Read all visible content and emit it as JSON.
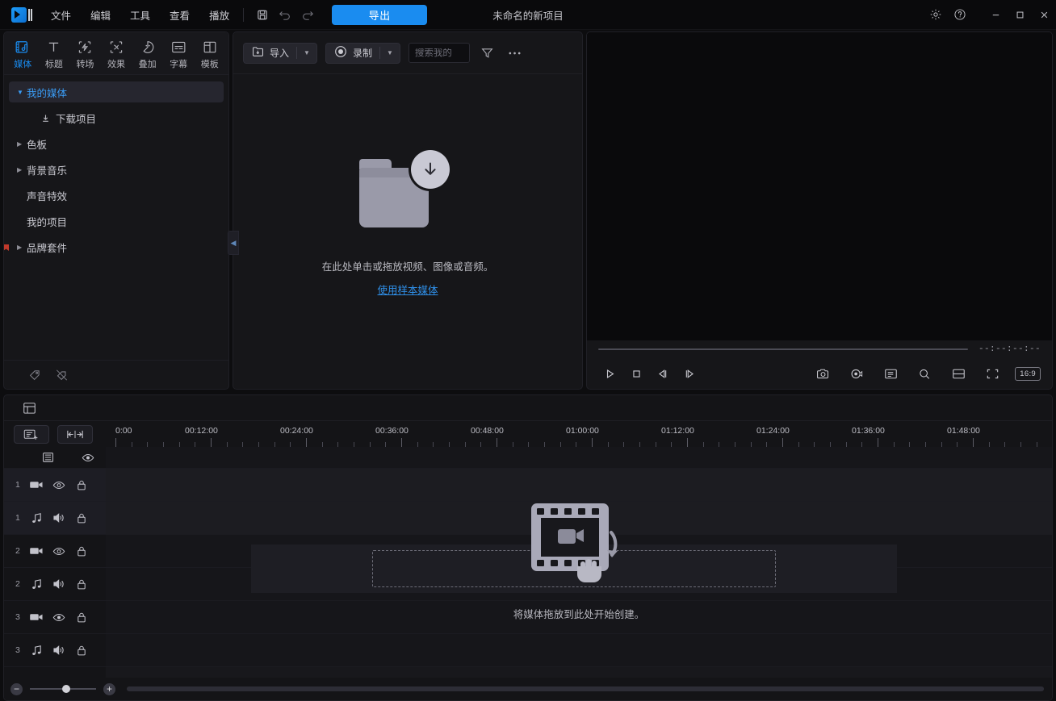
{
  "titlebar": {
    "menus": [
      "文件",
      "编辑",
      "工具",
      "查看",
      "播放"
    ],
    "save_icon": "save-icon",
    "undo_icon": "undo-icon",
    "redo_icon": "redo-icon",
    "export_label": "导出",
    "project_title": "未命名的新项目",
    "settings_icon": "gear-icon",
    "help_icon": "help-icon",
    "minimize_icon": "minimize-icon",
    "maximize_icon": "maximize-icon",
    "close_icon": "close-icon"
  },
  "category_tabs": [
    {
      "label": "媒体",
      "icon": "media-icon",
      "active": true
    },
    {
      "label": "标题",
      "icon": "text-title-icon",
      "active": false
    },
    {
      "label": "转场",
      "icon": "transition-icon",
      "active": false
    },
    {
      "label": "效果",
      "icon": "effects-icon",
      "active": false
    },
    {
      "label": "叠加",
      "icon": "overlay-icon",
      "active": false
    },
    {
      "label": "字幕",
      "icon": "subtitle-icon",
      "active": false
    },
    {
      "label": "模板",
      "icon": "template-icon",
      "active": false
    }
  ],
  "sidebar": {
    "items": [
      {
        "label": "我的媒体",
        "type": "expanded-parent",
        "selected": true
      },
      {
        "label": "下载项目",
        "type": "child-download",
        "selected": false
      },
      {
        "label": "色板",
        "type": "collapsed-parent",
        "selected": false
      },
      {
        "label": "背景音乐",
        "type": "collapsed-parent",
        "selected": false
      },
      {
        "label": "声音特效",
        "type": "leaf",
        "selected": false
      },
      {
        "label": "我的项目",
        "type": "leaf",
        "selected": false
      },
      {
        "label": "品牌套件",
        "type": "collapsed-parent",
        "selected": false,
        "badge": true
      }
    ],
    "footer_icons": [
      "tag-icon",
      "tag-off-icon"
    ],
    "collapse_icon": "chevron-left-icon"
  },
  "media_toolbar": {
    "import_label": "导入",
    "import_icon": "import-icon",
    "record_label": "录制",
    "record_icon": "record-icon",
    "search_placeholder": "搜索我的",
    "search_value": "",
    "filter_icon": "filter-icon",
    "more_icon": "more-options-icon"
  },
  "media_empty": {
    "folder_icon": "folder-download-icon",
    "hint": "在此处单击或拖放视频、图像或音频。",
    "sample_link": "使用样本媒体"
  },
  "preview": {
    "timecode": "--:--:--:--",
    "play_icon": "play-icon",
    "stop_icon": "stop-icon",
    "prev_frame_icon": "prev-frame-icon",
    "next_frame_icon": "next-frame-icon",
    "snapshot_icon": "camera-icon",
    "record_marker_icon": "record-dot-icon",
    "markers_icon": "markers-list-icon",
    "zoom_icon": "zoom-icon",
    "split_icon": "split-view-icon",
    "fullscreen_icon": "fullscreen-icon",
    "aspect_ratio": "16:9"
  },
  "timeline": {
    "top_tool_icon": "timeline-layout-icon",
    "add_track_icon": "add-track-icon",
    "fit_icon": "fit-to-screen-icon",
    "ruler_labels": [
      "0:00",
      "00:12:00",
      "00:24:00",
      "00:36:00",
      "00:48:00",
      "01:00:00",
      "01:12:00",
      "01:24:00",
      "01:36:00",
      "01:48:00"
    ],
    "master_track": {
      "video_icon": "master-video-icon",
      "eye_icon": "eye-icon"
    },
    "tracks": [
      {
        "num": "1",
        "kind": "video",
        "kind_icon": "video-camera-icon",
        "toggle_icon": "eye-icon",
        "lock_icon": "lock-icon",
        "highlight": true
      },
      {
        "num": "1",
        "kind": "audio",
        "kind_icon": "music-note-icon",
        "toggle_icon": "speaker-icon",
        "lock_icon": "lock-icon",
        "highlight": true
      },
      {
        "num": "2",
        "kind": "video",
        "kind_icon": "video-camera-icon",
        "toggle_icon": "eye-icon",
        "lock_icon": "lock-icon",
        "highlight": false
      },
      {
        "num": "2",
        "kind": "audio",
        "kind_icon": "music-note-icon",
        "toggle_icon": "speaker-icon",
        "lock_icon": "lock-icon",
        "highlight": false
      },
      {
        "num": "3",
        "kind": "video",
        "kind_icon": "video-camera-icon",
        "toggle_icon": "eye-icon",
        "lock_icon": "lock-icon",
        "highlight": false
      },
      {
        "num": "3",
        "kind": "audio",
        "kind_icon": "music-note-icon",
        "toggle_icon": "speaker-icon",
        "lock_icon": "lock-icon",
        "highlight": false
      }
    ],
    "empty_caption": "将媒体拖放到此处开始创建。",
    "empty_icon": "film-strip-drag-icon",
    "zoom_out_label": "−",
    "zoom_in_label": "+",
    "zoom_value": "55"
  },
  "colors": {
    "accent": "#1a8cf0",
    "link": "#2f8fe8",
    "panel_bg": "#161619",
    "app_bg": "#0d0d0f",
    "timeline_bg": "#141417"
  }
}
